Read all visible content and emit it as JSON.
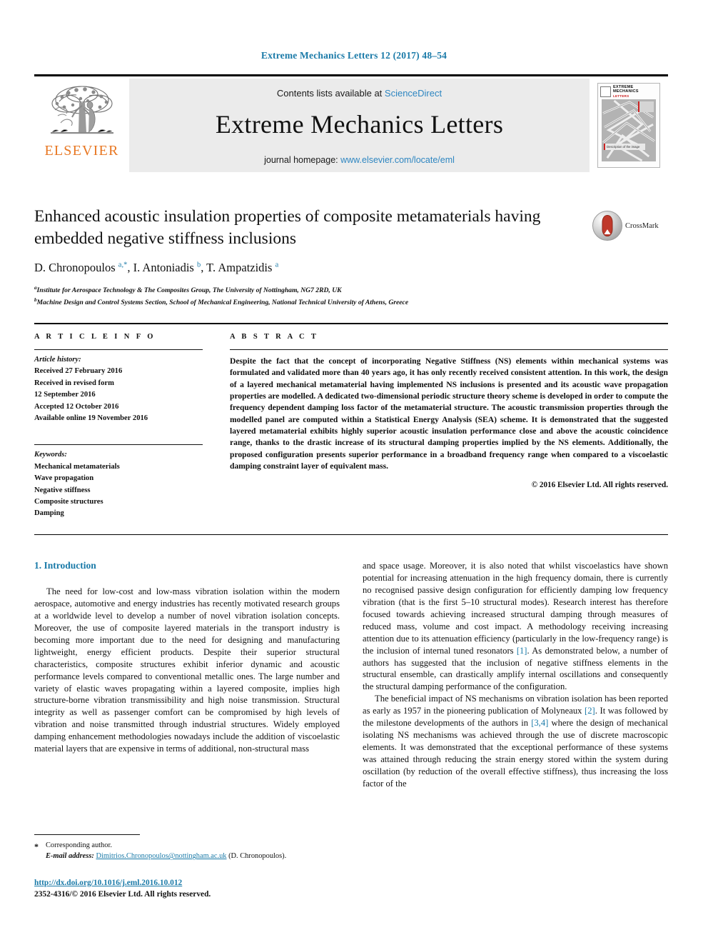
{
  "running_head": "Extreme Mechanics Letters 12 (2017) 48–54",
  "masthead": {
    "contents_prefix": "Contents lists available at ",
    "contents_link": "ScienceDirect",
    "journal_title": "Extreme Mechanics Letters",
    "homepage_prefix": "journal homepage: ",
    "homepage_link": "www.elsevier.com/locate/eml",
    "publisher_logo_text": "ELSEVIER",
    "cover": {
      "title_line1": "EXTREME MECHANICS",
      "title_line2": "LETTERS",
      "caption": "Description of the image"
    }
  },
  "article": {
    "title": "Enhanced acoustic insulation properties of composite metamaterials having embedded negative stiffness inclusions",
    "crossmark_label": "CrossMark",
    "authors_html": "D. Chronopoulos <sup>a,*</sup>, I. Antoniadis <sup>b</sup>, T. Ampatzidis <sup>a</sup>",
    "affiliations": [
      "Institute for Aerospace Technology & The Composites Group, The University of Nottingham, NG7 2RD, UK",
      "Machine Design and Control Systems Section, School of Mechanical Engineering, National Technical University of Athens, Greece"
    ],
    "affiliation_markers": [
      "a",
      "b"
    ]
  },
  "info": {
    "heading": "A R T I C L E   I N F O",
    "history_label": "Article history:",
    "history_lines": [
      "Received 27 February 2016",
      "Received in revised form",
      "12 September 2016",
      "Accepted 12 October 2016",
      "Available online 19 November 2016"
    ],
    "keywords_label": "Keywords:",
    "keywords": [
      "Mechanical metamaterials",
      "Wave propagation",
      "Negative stiffness",
      "Composite structures",
      "Damping"
    ]
  },
  "abstract": {
    "heading": "A B S T R A C T",
    "text": "Despite the fact that the concept of incorporating Negative Stiffness (NS) elements within mechanical systems was formulated and validated more than 40 years ago, it has only recently received consistent attention. In this work, the design of a layered mechanical metamaterial having implemented NS inclusions is presented and its acoustic wave propagation properties are modelled. A dedicated two-dimensional periodic structure theory scheme is developed in order to compute the frequency dependent damping loss factor of the metamaterial structure. The acoustic transmission properties through the modelled panel are computed within a Statistical Energy Analysis (SEA) scheme. It is demonstrated that the suggested layered metamaterial exhibits highly superior acoustic insulation performance close and above the acoustic coincidence range, thanks to the drastic increase of its structural damping properties implied by the NS elements. Additionally, the proposed configuration presents superior performance in a broadband frequency range when compared to a viscoelastic damping constraint layer of equivalent mass.",
    "copyright": "© 2016 Elsevier Ltd. All rights reserved."
  },
  "body": {
    "section_heading": "1. Introduction",
    "left_paragraph": "The need for low-cost and low-mass vibration isolation within the modern aerospace, automotive and energy industries has recently motivated research groups at a worldwide level to develop a number of novel vibration isolation concepts. Moreover, the use of composite layered materials in the transport industry is becoming more important due to the need for designing and manufacturing lightweight, energy efficient products. Despite their superior structural characteristics, composite structures exhibit inferior dynamic and acoustic performance levels compared to conventional metallic ones. The large number and variety of elastic waves propagating within a layered composite, implies high structure-borne vibration transmissibility and high noise transmission. Structural integrity as well as passenger comfort can be compromised by high levels of vibration and noise transmitted through industrial structures. Widely employed damping enhancement methodologies nowadays include the addition of viscoelastic material layers that are expensive in terms of additional, non-structural mass",
    "right_paragraph_1_part1": "and space usage. Moreover, it is also noted that whilst viscoelastics have shown potential for increasing attenuation in the high frequency domain, there is currently no recognised passive design configuration for efficiently damping low frequency vibration (that is the first 5–10 structural modes). Research interest has therefore focused towards achieving increased structural damping through measures of reduced mass, volume and cost impact. A methodology receiving increasing attention due to its attenuation efficiency (particularly in the low-frequency range) is the inclusion of internal tuned resonators ",
    "right_paragraph_1_ref": "[1]",
    "right_paragraph_1_part2": ". As demonstrated below, a number of authors has suggested that the inclusion of negative stiffness elements in the structural ensemble, can drastically amplify internal oscillations and consequently the structural damping performance of the configuration.",
    "right_paragraph_2_part1": "The beneficial impact of NS mechanisms on vibration isolation has been reported as early as 1957 in the pioneering publication of Molyneaux ",
    "right_paragraph_2_ref1": "[2]",
    "right_paragraph_2_part2": ". It was followed by the milestone developments of the authors in ",
    "right_paragraph_2_ref2": "[3,4]",
    "right_paragraph_2_part3": " where the design of mechanical isolating NS mechanisms was achieved through the use of discrete macroscopic elements. It was demonstrated that the exceptional performance of these systems was attained through reducing the strain energy stored within the system during oscillation (by reduction of the overall effective stiffness), thus increasing the loss factor of the"
  },
  "footer": {
    "corresponding_marker": "*",
    "corresponding_text": "Corresponding author.",
    "email_label": "E-mail address:",
    "email_address": "Dimitrios.Chronopoulos@nottingham.ac.uk",
    "email_owner": "(D. Chronopoulos).",
    "doi": "http://dx.doi.org/10.1016/j.eml.2016.10.012",
    "issn_line": "2352-4316/© 2016 Elsevier Ltd. All rights reserved."
  }
}
